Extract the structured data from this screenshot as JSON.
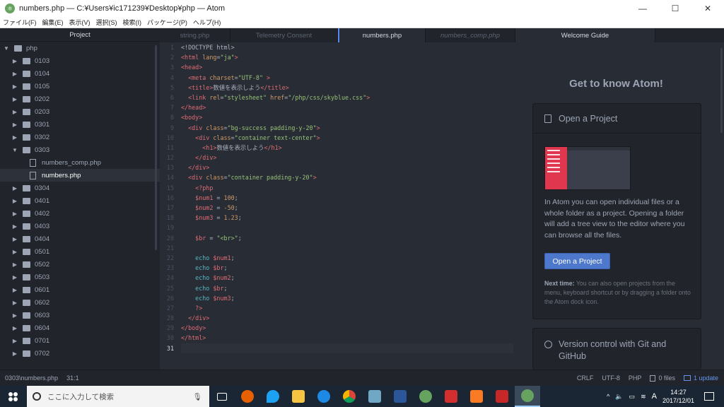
{
  "window": {
    "title": "numbers.php — C:¥Users¥ic171239¥Desktop¥php — Atom",
    "min": "—",
    "max": "☐",
    "close": "✕"
  },
  "menu": [
    "ファイル(F)",
    "編集(E)",
    "表示(V)",
    "選択(S)",
    "検索(I)",
    "パッケージ(P)",
    "ヘルプ(H)"
  ],
  "tree": {
    "header": "Project",
    "root": "php",
    "items": [
      {
        "label": "0103",
        "type": "dir"
      },
      {
        "label": "0104",
        "type": "dir"
      },
      {
        "label": "0105",
        "type": "dir"
      },
      {
        "label": "0202",
        "type": "dir"
      },
      {
        "label": "0203",
        "type": "dir"
      },
      {
        "label": "0301",
        "type": "dir"
      },
      {
        "label": "0302",
        "type": "dir"
      },
      {
        "label": "0303",
        "type": "open"
      },
      {
        "label": "numbers_comp.php",
        "type": "file"
      },
      {
        "label": "numbers.php",
        "type": "file",
        "selected": true
      },
      {
        "label": "0304",
        "type": "dir"
      },
      {
        "label": "0401",
        "type": "dir"
      },
      {
        "label": "0402",
        "type": "dir"
      },
      {
        "label": "0403",
        "type": "dir"
      },
      {
        "label": "0404",
        "type": "dir"
      },
      {
        "label": "0501",
        "type": "dir"
      },
      {
        "label": "0502",
        "type": "dir"
      },
      {
        "label": "0503",
        "type": "dir"
      },
      {
        "label": "0601",
        "type": "dir"
      },
      {
        "label": "0602",
        "type": "dir"
      },
      {
        "label": "0603",
        "type": "dir"
      },
      {
        "label": "0604",
        "type": "dir"
      },
      {
        "label": "0701",
        "type": "dir"
      },
      {
        "label": "0702",
        "type": "dir"
      }
    ]
  },
  "tabs": [
    {
      "label": "string.php",
      "active": false,
      "italic": false
    },
    {
      "label": "Telemetry Consent",
      "active": false,
      "italic": false
    },
    {
      "label": "numbers.php",
      "active": true,
      "italic": false
    },
    {
      "label": "numbers_comp.php",
      "active": false,
      "italic": true
    }
  ],
  "code": [
    [
      [
        "pl",
        "<!DOCTYPE html>"
      ]
    ],
    [
      [
        "tg",
        "<html "
      ],
      [
        "at",
        "lang"
      ],
      [
        "pl",
        "="
      ],
      [
        "st",
        "\"ja\""
      ],
      [
        "tg",
        ">"
      ]
    ],
    [
      [
        "tg",
        "<head>"
      ]
    ],
    [
      [
        "ws",
        "  "
      ],
      [
        "tg",
        "<meta "
      ],
      [
        "at",
        "charset"
      ],
      [
        "pl",
        "="
      ],
      [
        "st",
        "\"UTF-8\""
      ],
      [
        "pl",
        " "
      ],
      [
        "tg",
        ">"
      ]
    ],
    [
      [
        "ws",
        "  "
      ],
      [
        "tg",
        "<title>"
      ],
      [
        "pl",
        "数値を表示しよう"
      ],
      [
        "tg",
        "</title>"
      ]
    ],
    [
      [
        "ws",
        "  "
      ],
      [
        "tg",
        "<link "
      ],
      [
        "at",
        "rel"
      ],
      [
        "pl",
        "="
      ],
      [
        "st",
        "\"stylesheet\""
      ],
      [
        "pl",
        " "
      ],
      [
        "at",
        "href"
      ],
      [
        "pl",
        "="
      ],
      [
        "st",
        "\"/php/css/skyblue.css\""
      ],
      [
        "tg",
        ">"
      ]
    ],
    [
      [
        "tg",
        "</head>"
      ]
    ],
    [
      [
        "tg",
        "<body>"
      ]
    ],
    [
      [
        "ws",
        "  "
      ],
      [
        "tg",
        "<div "
      ],
      [
        "at",
        "class"
      ],
      [
        "pl",
        "="
      ],
      [
        "st",
        "\"bg-success padding-y-20\""
      ],
      [
        "tg",
        ">"
      ]
    ],
    [
      [
        "ws",
        "    "
      ],
      [
        "tg",
        "<div "
      ],
      [
        "at",
        "class"
      ],
      [
        "pl",
        "="
      ],
      [
        "st",
        "\"container text-center\""
      ],
      [
        "tg",
        ">"
      ]
    ],
    [
      [
        "ws",
        "      "
      ],
      [
        "tg",
        "<h1>"
      ],
      [
        "pl",
        "数値を表示しよう"
      ],
      [
        "tg",
        "</h1>"
      ]
    ],
    [
      [
        "ws",
        "    "
      ],
      [
        "tg",
        "</div>"
      ]
    ],
    [
      [
        "ws",
        "  "
      ],
      [
        "tg",
        "</div>"
      ]
    ],
    [
      [
        "ws",
        "  "
      ],
      [
        "tg",
        "<div "
      ],
      [
        "at",
        "class"
      ],
      [
        "pl",
        "="
      ],
      [
        "st",
        "\"container padding-y-20\""
      ],
      [
        "tg",
        ">"
      ]
    ],
    [
      [
        "ws",
        "    "
      ],
      [
        "tg",
        "<?php"
      ]
    ],
    [
      [
        "ws",
        "    "
      ],
      [
        "vr",
        "$num1"
      ],
      [
        "pl",
        " = "
      ],
      [
        "nm",
        "100"
      ],
      [
        "pl",
        ";"
      ]
    ],
    [
      [
        "ws",
        "    "
      ],
      [
        "vr",
        "$num2"
      ],
      [
        "pl",
        " = "
      ],
      [
        "nm",
        "-50"
      ],
      [
        "pl",
        ";"
      ]
    ],
    [
      [
        "ws",
        "    "
      ],
      [
        "vr",
        "$num3"
      ],
      [
        "pl",
        " = "
      ],
      [
        "nm",
        "1.23"
      ],
      [
        "pl",
        ";"
      ]
    ],
    [],
    [
      [
        "ws",
        "    "
      ],
      [
        "vr",
        "$br"
      ],
      [
        "pl",
        " = "
      ],
      [
        "st",
        "\"<br>\""
      ],
      [
        "pl",
        ";"
      ]
    ],
    [],
    [
      [
        "ws",
        "    "
      ],
      [
        "kw",
        "echo "
      ],
      [
        "vr",
        "$num1"
      ],
      [
        "pl",
        ";"
      ]
    ],
    [
      [
        "ws",
        "    "
      ],
      [
        "kw",
        "echo "
      ],
      [
        "vr",
        "$br"
      ],
      [
        "pl",
        ";"
      ]
    ],
    [
      [
        "ws",
        "    "
      ],
      [
        "kw",
        "echo "
      ],
      [
        "vr",
        "$num2"
      ],
      [
        "pl",
        ";"
      ]
    ],
    [
      [
        "ws",
        "    "
      ],
      [
        "kw",
        "echo "
      ],
      [
        "vr",
        "$br"
      ],
      [
        "pl",
        ";"
      ]
    ],
    [
      [
        "ws",
        "    "
      ],
      [
        "kw",
        "echo "
      ],
      [
        "vr",
        "$num3"
      ],
      [
        "pl",
        ";"
      ]
    ],
    [
      [
        "ws",
        "    "
      ],
      [
        "tg",
        "?>"
      ]
    ],
    [
      [
        "ws",
        "  "
      ],
      [
        "tg",
        "</div>"
      ]
    ],
    [
      [
        "tg",
        "</body>"
      ]
    ],
    [
      [
        "tg",
        "</html>"
      ]
    ],
    []
  ],
  "welcome": {
    "tab": "Welcome Guide",
    "title": "Get to know Atom!",
    "card1": {
      "heading": "Open a Project",
      "body": "In Atom you can open individual files or a whole folder as a project. Opening a folder will add a tree view to the editor where you can browse all the files.",
      "button": "Open a Project",
      "next_bold": "Next time:",
      "next_text": " You can also open projects from the menu, keyboard shortcut or by dragging a folder onto the Atom dock icon."
    },
    "card2": {
      "heading": "Version control with Git and GitHub"
    }
  },
  "status": {
    "path": "0303\\numbers.php",
    "cursor": "31:1",
    "eol": "CRLF",
    "encoding": "UTF-8",
    "grammar": "PHP",
    "files": "0 files",
    "update": "1 update"
  },
  "taskbar": {
    "search_placeholder": "ここに入力して検索",
    "time": "14:27",
    "date": "2017/12/01",
    "ime": "A"
  },
  "colors": {
    "accent": "#4d78cc",
    "tag": "#e06c75",
    "attr": "#d19a66",
    "string": "#98c379",
    "keyword": "#56b6c2"
  }
}
